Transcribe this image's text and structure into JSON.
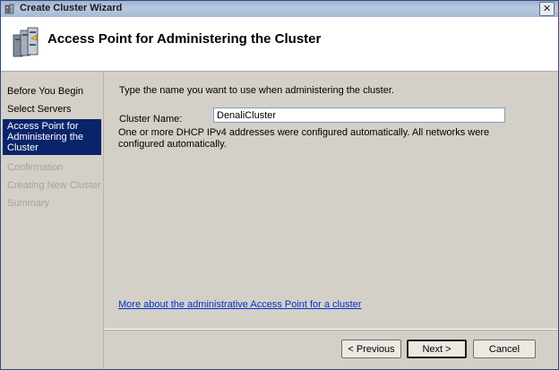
{
  "window": {
    "title": "Create Cluster Wizard",
    "close_glyph": "✕"
  },
  "header": {
    "title": "Access Point for Administering the Cluster",
    "icon": "cluster-servers-icon"
  },
  "nav": {
    "items": [
      {
        "label": "Before You Begin",
        "state": "normal"
      },
      {
        "label": "Select Servers",
        "state": "normal"
      },
      {
        "label": "Access Point for Administering the Cluster",
        "state": "active"
      },
      {
        "label": "Confirmation",
        "state": "disabled"
      },
      {
        "label": "Creating New Cluster",
        "state": "disabled"
      },
      {
        "label": "Summary",
        "state": "disabled"
      }
    ]
  },
  "main": {
    "instruction": "Type the name you want to use when administering the cluster.",
    "cluster_name_label": "Cluster Name:",
    "cluster_name_value": "DenaliCluster",
    "dhcp_message": "One or more DHCP IPv4 addresses were configured automatically.  All networks were configured automatically.",
    "help_link": "More about the administrative Access Point for a cluster"
  },
  "footer": {
    "previous_label": "< Previous",
    "next_label": "Next >",
    "cancel_label": "Cancel"
  },
  "colors": {
    "active_nav_bg": "#0a246a",
    "disabled_text": "#a6a39c",
    "link": "#0033cc"
  }
}
